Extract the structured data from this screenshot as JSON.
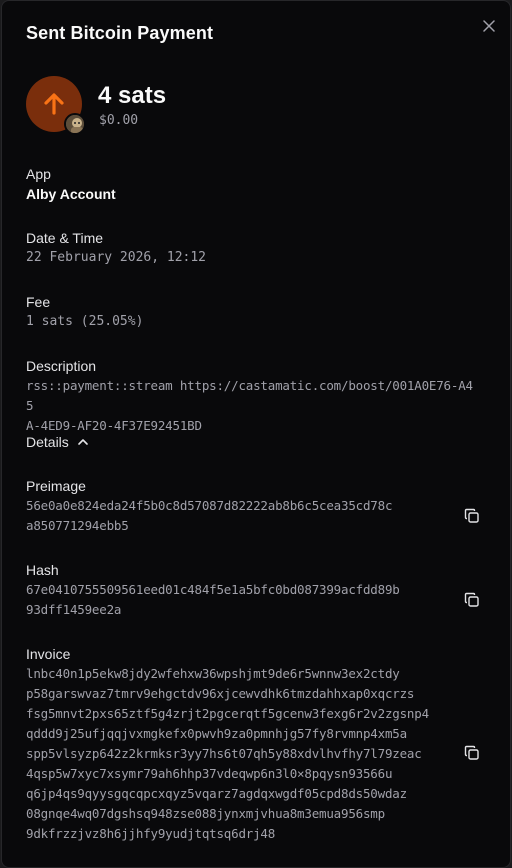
{
  "dialog": {
    "title": "Sent Bitcoin Payment",
    "close_icon": "close-icon"
  },
  "payment": {
    "direction_icon": "arrow-up-icon",
    "amount": "4 sats",
    "fiat": "$0.00"
  },
  "app": {
    "label": "App",
    "value": "Alby Account"
  },
  "datetime": {
    "label": "Date & Time",
    "value": "22 February 2026, 12:12"
  },
  "fee": {
    "label": "Fee",
    "value": "1 sats (25.05%)"
  },
  "description": {
    "label": "Description",
    "lines": [
      "rss::payment::stream https://castamatic.com/boost/001A0E76-A45",
      "A-4ED9-AF20-4F37E92451BD"
    ]
  },
  "details": {
    "label": "Details",
    "icon": "chevron-up-icon"
  },
  "preimage": {
    "label": "Preimage",
    "lines": [
      "56e0a0e824eda24f5b0c8d57087d82222ab8b6c5cea35cd78c",
      "a850771294ebb5"
    ]
  },
  "hash": {
    "label": "Hash",
    "lines": [
      "67e0410755509561eed01c484f5e1a5bfc0bd087399acfdd89b",
      "93dff1459ee2a"
    ]
  },
  "invoice": {
    "label": "Invoice",
    "lines": [
      "lnbc40n1p5ekw8jdy2wfehxw36wpshjmt9de6r5wnnw3ex2ctdy",
      "p58garswvaz7tmrv9ehgctdv96xjcewvdhk6tmzdahhxap0xqcrzs",
      "fsg5mnvt2pxs65ztf5g4zrjt2pgcerqtf5gcenw3fexg6r2v2zgsnp4",
      "qddd9j25ufjqqjvxmgkefx0pwvh9za0pmnhjg57fy8rvmnp4xm5a",
      "spp5vlsyzp642z2krmksr3yy7hs6t07qh5y88xdvlhvfhy7l79zeac",
      "4qsp5w7xyc7xsymr79ah6hhp37vdeqwp6n3l0×8pqysn93566u",
      "q6jp4qs9qyysgqcqpcxqyz5vqarz7agdqxwgdf05cpd8ds50wdaz",
      "08gnqe4wq07dgshsq948zse088jynxmjvhua8m3emua956smp",
      "9dkfrzzjvz8h6jjhfy9yudjtqtsq6drj48"
    ]
  },
  "colors": {
    "accent": "#f97316",
    "accent_bg": "#7a2e0c",
    "background": "#09090b",
    "muted_text": "#a1a1aa"
  }
}
